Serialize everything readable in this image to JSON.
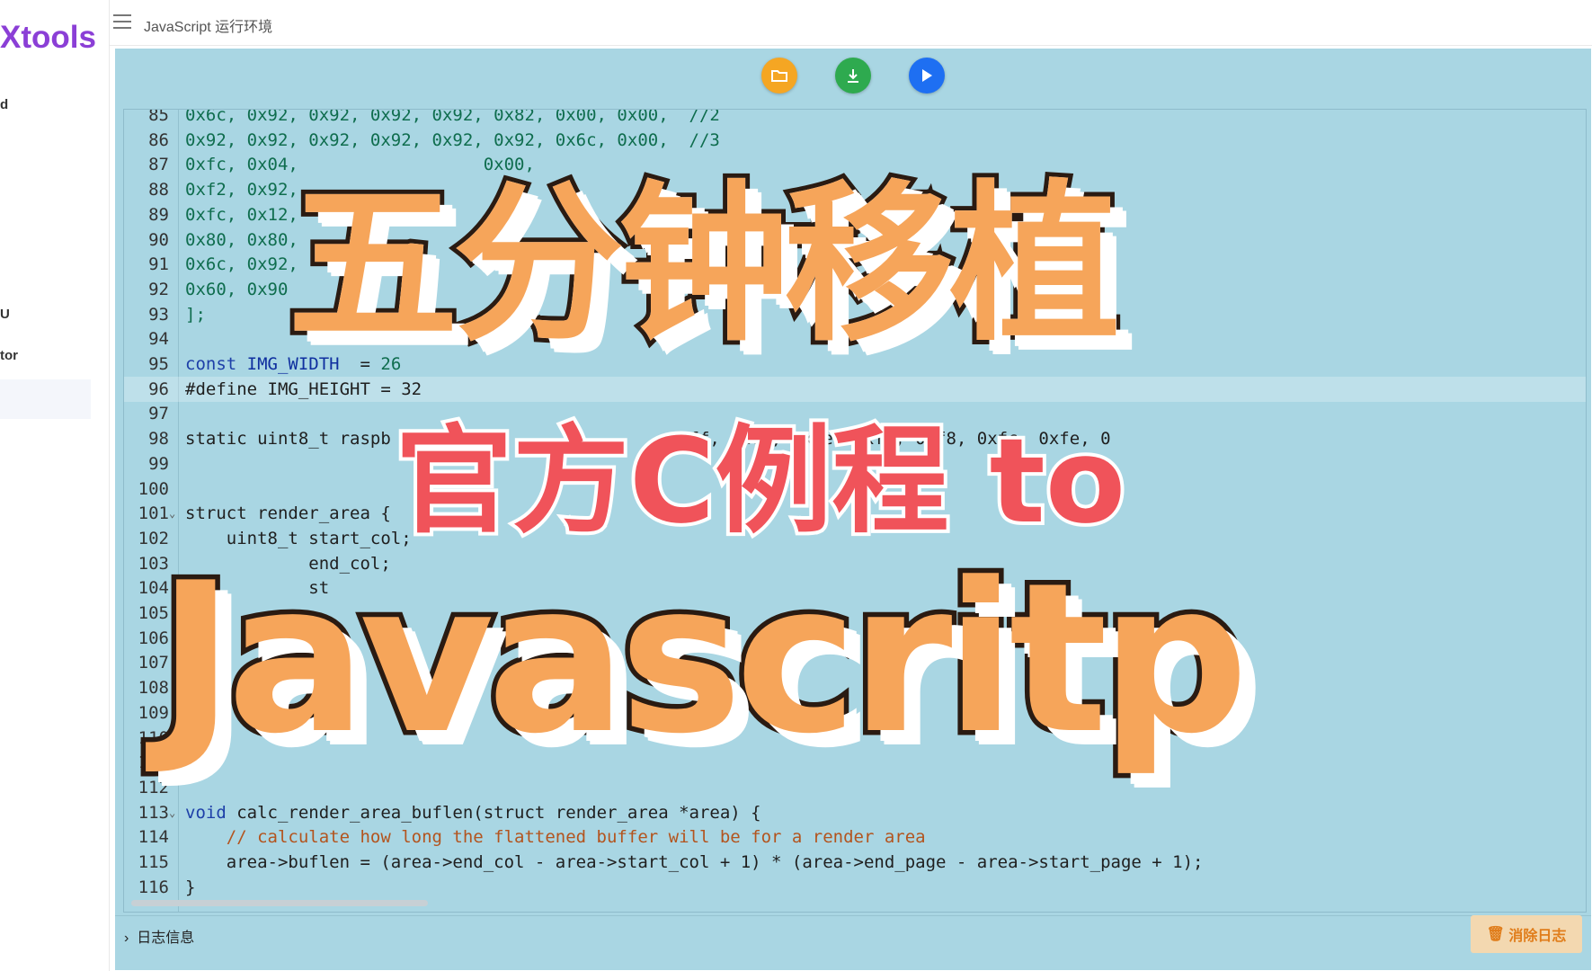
{
  "app": {
    "brand": "Xtools",
    "page_title": "JavaScript 运行环境"
  },
  "sidebar": {
    "items": [
      {
        "label": "d"
      },
      {
        "label": "U"
      },
      {
        "label": "tor"
      }
    ]
  },
  "toolbar": {
    "open_icon": "folder-open-icon",
    "download_icon": "download-icon",
    "run_icon": "play-icon",
    "colors": {
      "open": "#f5a623",
      "download": "#2eaa4f",
      "run": "#1e6ff2"
    }
  },
  "editor": {
    "lines": [
      {
        "n": "85",
        "text": "0x6c, 0x92, 0x92, 0x92, 0x92, 0x82, 0x00, 0x00,  //2"
      },
      {
        "n": "86",
        "text": "0x92, 0x92, 0x92, 0x92, 0x92, 0x92, 0x6c, 0x00,  //3"
      },
      {
        "n": "87",
        "text": "0xfc, 0x04,                  0x00,"
      },
      {
        "n": "88",
        "text": "0xf2, 0x92,"
      },
      {
        "n": "89",
        "text": "0xfc, 0x12,"
      },
      {
        "n": "90",
        "text": "0x80, 0x80,"
      },
      {
        "n": "91",
        "text": "0x6c, 0x92,"
      },
      {
        "n": "92",
        "text": "0x60, 0x90"
      },
      {
        "n": "93",
        "text": "];"
      },
      {
        "n": "94",
        "text": ""
      },
      {
        "n": "95",
        "text": "const IMG_WIDTH  = 26"
      },
      {
        "n": "96",
        "text": "#define IMG_HEIGHT = 32"
      },
      {
        "n": "97",
        "text": ""
      },
      {
        "n": "98",
        "text": "static uint8_t raspb                             ff, 0xfe, 0xfe, 0xfc, 0xf8, 0xfc, 0xfe, 0"
      },
      {
        "n": "99",
        "text": ""
      },
      {
        "n": "100",
        "text": ""
      },
      {
        "n": "101",
        "text": "struct render_area {"
      },
      {
        "n": "102",
        "text": "    uint8_t start_col;"
      },
      {
        "n": "103",
        "text": "            end_col;"
      },
      {
        "n": "104",
        "text": "            st"
      },
      {
        "n": "105",
        "text": ""
      },
      {
        "n": "106",
        "text": ""
      },
      {
        "n": "107",
        "text": ""
      },
      {
        "n": "108",
        "text": ""
      },
      {
        "n": "109",
        "text": ""
      },
      {
        "n": "110",
        "text": ""
      },
      {
        "n": "111",
        "text": ""
      },
      {
        "n": "112",
        "text": ""
      },
      {
        "n": "113",
        "text": "void calc_render_area_buflen(struct render_area *area) {"
      },
      {
        "n": "114",
        "text": "    // calculate how long the flattened buffer will be for a render area"
      },
      {
        "n": "115",
        "text": "    area->buflen = (area->end_col - area->start_col + 1) * (area->end_page - area->start_page + 1);"
      },
      {
        "n": "116",
        "text": "}"
      }
    ]
  },
  "log": {
    "label": "日志信息",
    "clear_label": "消除日志",
    "clear_icon": "trash-icon"
  },
  "overlay": {
    "title1": "五分钟移植",
    "title2": "官方C例程 to",
    "title3": "Javascritp"
  }
}
